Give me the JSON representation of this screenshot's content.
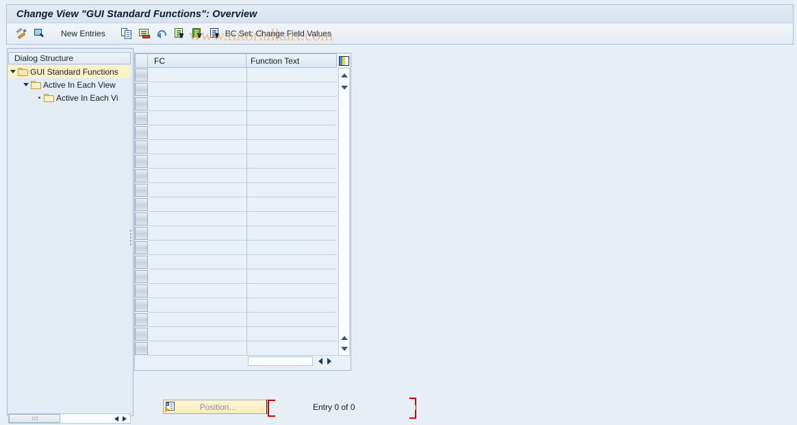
{
  "window": {
    "title": "Change View \"GUI Standard Functions\": Overview"
  },
  "watermark": "www.tutorialkart.com",
  "toolbar": {
    "items": [
      {
        "name": "display-change-icon",
        "label": ""
      },
      {
        "name": "display-icon",
        "label": ""
      },
      {
        "name": "new-entries-button",
        "label": "New Entries"
      },
      {
        "name": "copy-as-icon",
        "label": ""
      },
      {
        "name": "delete-icon",
        "label": ""
      },
      {
        "name": "undo-icon",
        "label": ""
      },
      {
        "name": "select-all-icon",
        "label": ""
      },
      {
        "name": "select-block-icon",
        "label": ""
      },
      {
        "name": "bc-set-icon",
        "label": ""
      }
    ],
    "new_entries_label": "New Entries",
    "bc_set_label": "BC Set: Change Field Values"
  },
  "sidebar": {
    "header": "Dialog Structure",
    "items": [
      {
        "label": "GUI Standard Functions",
        "level": 0,
        "expanded": true,
        "selected": true
      },
      {
        "label": "Active In Each View",
        "level": 1,
        "expanded": true,
        "selected": false
      },
      {
        "label": "Active In Each Vi",
        "level": 2,
        "expanded": false,
        "selected": false
      }
    ]
  },
  "table": {
    "columns": [
      "FC",
      "Function Text"
    ],
    "rows": [
      {
        "fc": "",
        "function_text": ""
      },
      {
        "fc": "",
        "function_text": ""
      },
      {
        "fc": "",
        "function_text": ""
      },
      {
        "fc": "",
        "function_text": ""
      },
      {
        "fc": "",
        "function_text": ""
      },
      {
        "fc": "",
        "function_text": ""
      },
      {
        "fc": "",
        "function_text": ""
      },
      {
        "fc": "",
        "function_text": ""
      },
      {
        "fc": "",
        "function_text": ""
      },
      {
        "fc": "",
        "function_text": ""
      },
      {
        "fc": "",
        "function_text": ""
      },
      {
        "fc": "",
        "function_text": ""
      },
      {
        "fc": "",
        "function_text": ""
      },
      {
        "fc": "",
        "function_text": ""
      },
      {
        "fc": "",
        "function_text": ""
      },
      {
        "fc": "",
        "function_text": ""
      },
      {
        "fc": "",
        "function_text": ""
      },
      {
        "fc": "",
        "function_text": ""
      },
      {
        "fc": "",
        "function_text": ""
      },
      {
        "fc": "",
        "function_text": ""
      }
    ]
  },
  "footer": {
    "position_label": "Position...",
    "entry_status": "Entry 0 of 0"
  },
  "colors": {
    "accent": "#fbf3c8",
    "bracket": "#cc0000",
    "watermark": "#e8a05a",
    "panel_border": "#9fb6cc"
  }
}
